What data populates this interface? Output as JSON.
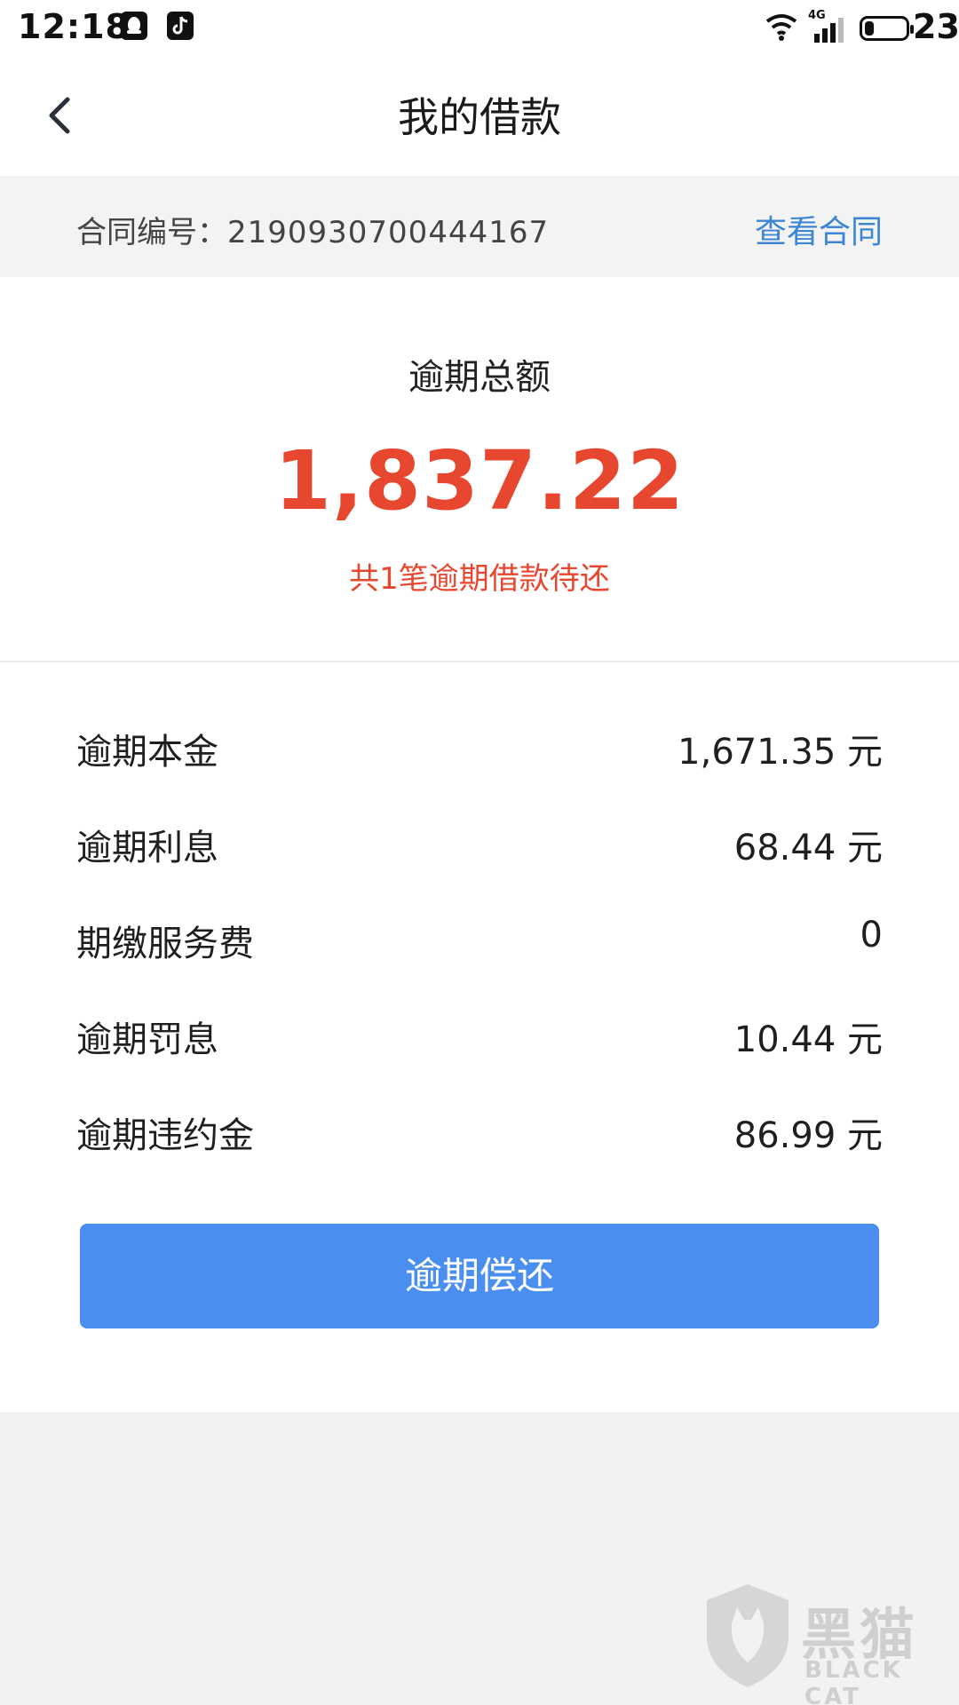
{
  "status_bar": {
    "time": "12:18",
    "network_type": "4G",
    "battery_level": "23",
    "battery_fraction": 0.23,
    "notification_icons": [
      "qq-icon",
      "tiktok-icon"
    ],
    "system_icons": [
      "wifi-icon",
      "signal-icon",
      "battery-icon"
    ]
  },
  "nav": {
    "back_icon": "chevron-left-icon",
    "title": "我的借款"
  },
  "contract": {
    "label": "合同编号：",
    "number": "2190930700444167",
    "view_link": "查看合同"
  },
  "summary": {
    "label": "逾期总额",
    "amount": "1,837.22",
    "note": "共1笔逾期借款待还"
  },
  "details": [
    {
      "label": "逾期本金",
      "value": "1,671.35 元"
    },
    {
      "label": "逾期利息",
      "value": "68.44 元"
    },
    {
      "label": "期缴服务费",
      "value": "0"
    },
    {
      "label": "逾期罚息",
      "value": "10.44 元"
    },
    {
      "label": "逾期违约金",
      "value": "86.99 元"
    }
  ],
  "actions": {
    "repay_label": "逾期偿还"
  },
  "watermark": {
    "cn": "黑猫",
    "en": "BLACK CAT"
  },
  "colors": {
    "accent_blue": "#4a8ef0",
    "link_blue": "#3d86d6",
    "overdue_red": "#e8472f",
    "strip_grey": "#f3f3f3"
  }
}
